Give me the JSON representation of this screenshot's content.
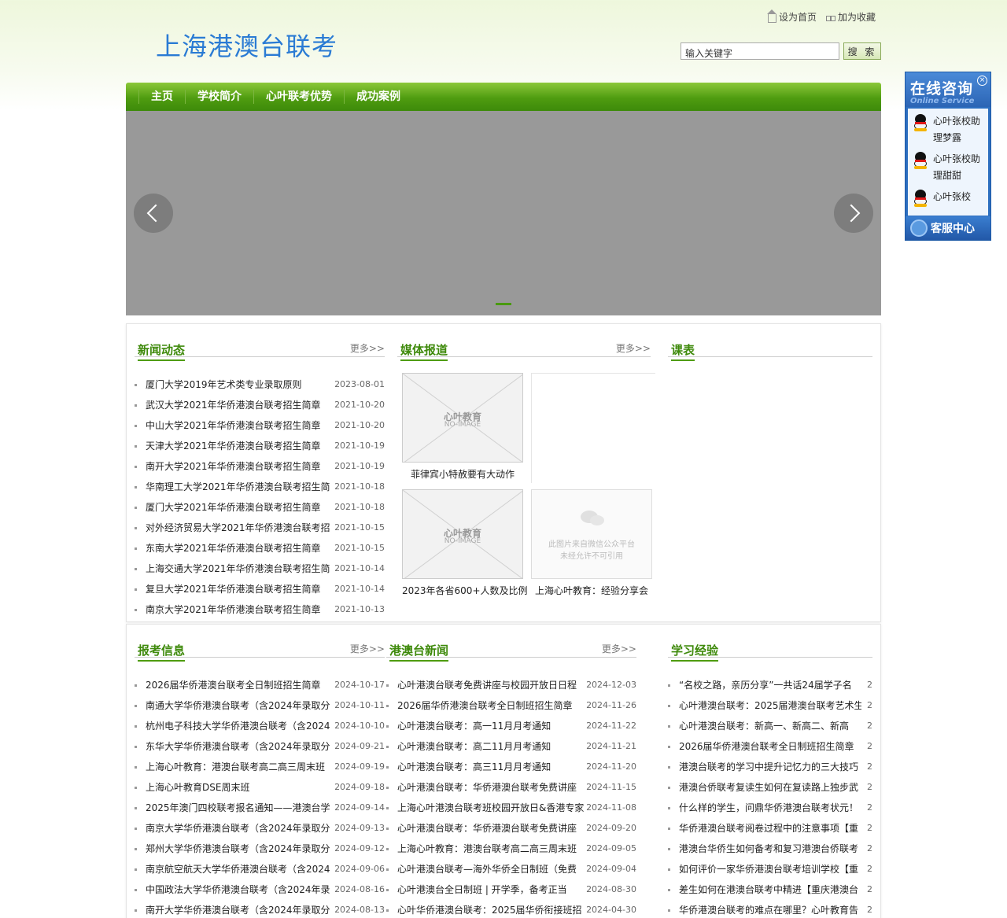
{
  "header": {
    "site_title": "上海港澳台联考",
    "set_home": "设为首页",
    "add_fav": "加为收藏",
    "search_placeholder": "输入关键字",
    "search_value": "输入关键字",
    "search_button": "搜 索"
  },
  "nav": [
    "主页",
    "学校简介",
    "心叶联考优势",
    "成功案例"
  ],
  "more_label": "更多>>",
  "news": {
    "title": "新闻动态",
    "items": [
      {
        "t": "厦门大学2019年艺术类专业录取原则",
        "d": "2023-08-01"
      },
      {
        "t": "武汉大学2021年华侨港澳台联考招生简章",
        "d": "2021-10-20"
      },
      {
        "t": "中山大学2021年华侨港澳台联考招生简章",
        "d": "2021-10-20"
      },
      {
        "t": "天津大学2021年华侨港澳台联考招生简章",
        "d": "2021-10-19"
      },
      {
        "t": "南开大学2021年华侨港澳台联考招生简章",
        "d": "2021-10-19"
      },
      {
        "t": "华南理工大学2021年华侨港澳台联考招生简",
        "d": "2021-10-18"
      },
      {
        "t": "厦门大学2021年华侨港澳台联考招生简章",
        "d": "2021-10-18"
      },
      {
        "t": "对外经济贸易大学2021年华侨港澳台联考招",
        "d": "2021-10-15"
      },
      {
        "t": "东南大学2021年华侨港澳台联考招生简章",
        "d": "2021-10-15"
      },
      {
        "t": "上海交通大学2021年华侨港澳台联考招生简",
        "d": "2021-10-14"
      },
      {
        "t": "复旦大学2021年华侨港澳台联考招生简章",
        "d": "2021-10-14"
      },
      {
        "t": "南京大学2021年华侨港澳台联考招生简章",
        "d": "2021-10-13"
      }
    ]
  },
  "media": {
    "title": "媒体报道",
    "noimage_main": "心叶教育",
    "noimage_sub": "NO-IMAGE",
    "wechat_line1": "此图片来自微信公众平台",
    "wechat_line2": "未经允许不可引用",
    "captions": [
      "菲律宾小特赦要有大动作",
      "2023年各省600+人数及比例",
      "上海心叶教育：经验分享会"
    ]
  },
  "schedule": {
    "title": "课表"
  },
  "exam_info": {
    "title": "报考信息",
    "items": [
      {
        "t": "2026届华侨港澳台联考全日制班招生简章",
        "d": "2024-10-17"
      },
      {
        "t": "南通大学华侨港澳台联考（含2024年录取分",
        "d": "2024-10-11"
      },
      {
        "t": "杭州电子科技大学华侨港澳台联考（含2024",
        "d": "2024-10-10"
      },
      {
        "t": "东华大学华侨港澳台联考（含2024年录取分",
        "d": "2024-09-21"
      },
      {
        "t": "上海心叶教育：港澳台联考高二高三周末班",
        "d": "2024-09-19"
      },
      {
        "t": "上海心叶教育DSE周末班",
        "d": "2024-09-18"
      },
      {
        "t": "2025年澳门四校联考报名通知——港澳台学",
        "d": "2024-09-14"
      },
      {
        "t": "南京大学华侨港澳台联考（含2024年录取分",
        "d": "2024-09-13"
      },
      {
        "t": "郑州大学华侨港澳台联考（含2024年录取分",
        "d": "2024-09-12"
      },
      {
        "t": "南京航空航天大学华侨港澳台联考（含2024",
        "d": "2024-09-06"
      },
      {
        "t": "中国政法大学华侨港澳台联考（含2024年录",
        "d": "2024-08-16"
      },
      {
        "t": "南开大学华侨港澳台联考（含2024年录取分",
        "d": "2024-08-13"
      }
    ]
  },
  "hmt_news": {
    "title": "港澳台新闻",
    "items": [
      {
        "t": "心叶港澳台联考免费讲座与校园开放日日程",
        "d": "2024-12-03"
      },
      {
        "t": "2026届华侨港澳台联考全日制班招生简章",
        "d": "2024-11-26"
      },
      {
        "t": "心叶港澳台联考：高一11月月考通知",
        "d": "2024-11-22"
      },
      {
        "t": "心叶港澳台联考：高二11月月考通知",
        "d": "2024-11-21"
      },
      {
        "t": "心叶港澳台联考：高三11月月考通知",
        "d": "2024-11-20"
      },
      {
        "t": "心叶港澳台联考：华侨港澳台联考免费讲座",
        "d": "2024-11-15"
      },
      {
        "t": "上海心叶港澳台联考班校园开放日&香港专家",
        "d": "2024-11-08"
      },
      {
        "t": "心叶港澳台联考：华侨港澳台联考免费讲座",
        "d": "2024-09-20"
      },
      {
        "t": "上海心叶教育：港澳台联考高二高三周末班",
        "d": "2024-09-05"
      },
      {
        "t": "心叶港澳台联考—海外华侨全日制班（免费",
        "d": "2024-09-04"
      },
      {
        "t": "心叶港澳台全日制班 | 开学季，备考正当",
        "d": "2024-08-30"
      },
      {
        "t": "心叶华侨港澳台联考：2025届华侨衔接班招",
        "d": "2024-04-30"
      }
    ]
  },
  "experience": {
    "title": "学习经验",
    "items": [
      {
        "t": "“名校之路，亲历分享”一共话24届学子名",
        "d": "2"
      },
      {
        "t": "心叶港澳台联考：2025届港澳台联考艺术生",
        "d": "2"
      },
      {
        "t": "心叶港澳台联考：新高一、新高二、新高",
        "d": "2"
      },
      {
        "t": "2026届华侨港澳台联考全日制班招生简章",
        "d": "2"
      },
      {
        "t": "港澳台联考的学习中提升记忆力的三大技巧",
        "d": "2"
      },
      {
        "t": "港澳台侨联考复读生如何在复读路上独步武",
        "d": "2"
      },
      {
        "t": "什么样的学生，问鼎华侨港澳台联考状元！",
        "d": "2"
      },
      {
        "t": "华侨港澳台联考阅卷过程中的注意事项【重",
        "d": "2"
      },
      {
        "t": "港澳台华侨生如何备考和复习港澳台侨联考",
        "d": "2"
      },
      {
        "t": "如何评价一家华侨港澳台联考培训学校【重",
        "d": "2"
      },
      {
        "t": "差生如何在港澳台联考中精进【重庆港澳台",
        "d": "2"
      },
      {
        "t": "华侨港澳台联考的难点在哪里？心叶教育告",
        "d": "2"
      }
    ]
  },
  "service": {
    "title": "在线咨询",
    "subtitle": "Online Service",
    "close": "×",
    "agents": [
      "心叶张校助理梦露",
      "心叶张校助理甜甜",
      "心叶张校"
    ],
    "footer": "客服中心"
  }
}
